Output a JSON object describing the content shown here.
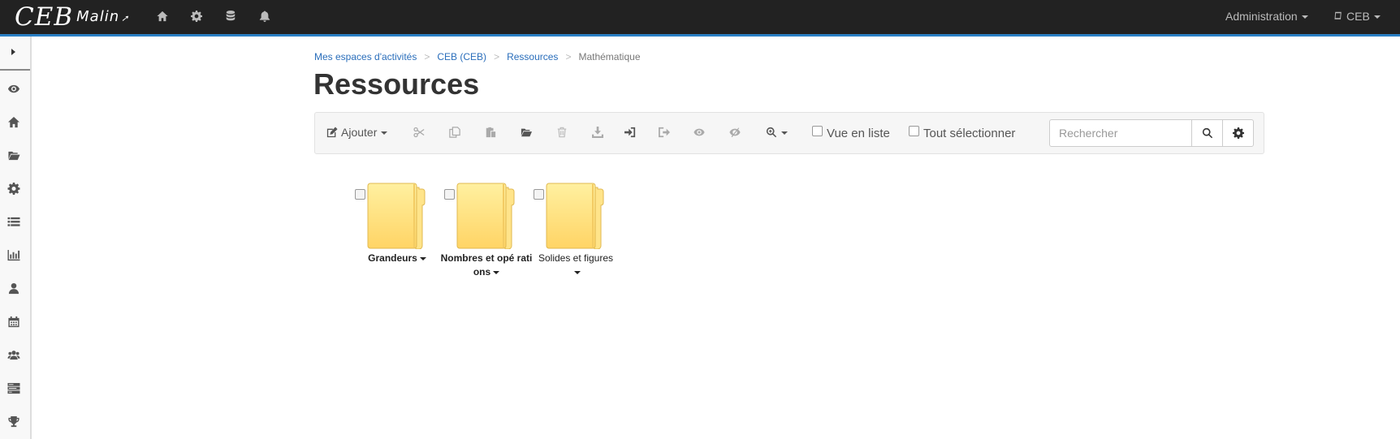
{
  "navbar": {
    "logo_main": "CEB",
    "logo_sub": "Malin",
    "icons": [
      "home-icon",
      "cog-icon",
      "database-icon",
      "bell-icon"
    ],
    "admin_label": "Administration",
    "workspace_label": "CEB",
    "accent_color": "#2a7fc4",
    "background_color": "#222222"
  },
  "sidebar": {
    "items": [
      "eye-icon",
      "home-icon",
      "folder-open-icon",
      "cog-icon",
      "list-icon",
      "bar-chart-icon",
      "user-icon",
      "calendar-icon",
      "users-icon",
      "tasks-icon",
      "trophy-icon"
    ]
  },
  "breadcrumb": {
    "items": [
      "Mes espaces d'activités",
      "CEB (CEB)",
      "Ressources"
    ],
    "separator": ">",
    "current": "Mathématique"
  },
  "page": {
    "title": "Ressources"
  },
  "toolbar": {
    "add_label": "Ajouter",
    "icons": [
      "cut-icon",
      "copy-icon",
      "paste-icon",
      "folder-open-icon",
      "trash-icon",
      "download-icon",
      "sign-in-icon",
      "sign-out-icon",
      "eye-icon",
      "eye-slash-icon",
      "zoom-icon"
    ],
    "list_view_label": "Vue en liste",
    "select_all_label": "Tout sélectionner",
    "search_placeholder": "Rechercher"
  },
  "folders": [
    {
      "name": "Grandeurs",
      "bold": true
    },
    {
      "name": "Nombres et opé rations",
      "bold": true
    },
    {
      "name": "Solides et figures",
      "bold": false
    }
  ]
}
